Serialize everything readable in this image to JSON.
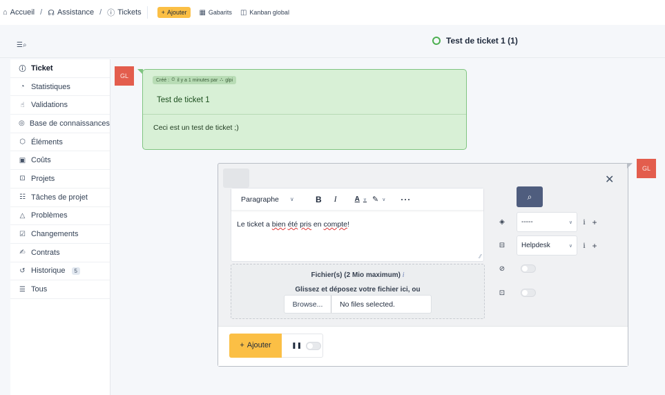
{
  "breadcrumb": {
    "home": "Accueil",
    "assistance": "Assistance",
    "tickets": "Tickets",
    "sep": "/"
  },
  "topbar": {
    "add_label": "Ajouter",
    "templates_label": "Gabarits",
    "kanban_label": "Kanban global"
  },
  "ticket": {
    "title": "Test de ticket 1 (1)",
    "status_color": "#4caf50",
    "created_badge": "Créé : ⏲ il y a 1 minutes par ⛬ glpi",
    "created_label": "Créé :",
    "created_time": "il y a 1 minutes par",
    "created_user": "glpi",
    "content_title": "Test de ticket 1",
    "content_body": "Ceci est un test de ticket ;)"
  },
  "avatar": {
    "initials": "GL",
    "color": "#e35d4d"
  },
  "sidebar": {
    "items": [
      {
        "label": "Ticket",
        "icon": "alert-circle-icon",
        "active": true
      },
      {
        "label": "Statistiques",
        "icon": "chart-pie-icon"
      },
      {
        "label": "Validations",
        "icon": "thumb-up-icon"
      },
      {
        "label": "Base de connaissances",
        "icon": "lifebuoy-icon"
      },
      {
        "label": "Éléments",
        "icon": "package-icon"
      },
      {
        "label": "Coûts",
        "icon": "wallet-icon"
      },
      {
        "label": "Projets",
        "icon": "projects-icon"
      },
      {
        "label": "Tâches de projet",
        "icon": "list-check-icon"
      },
      {
        "label": "Problèmes",
        "icon": "alert-triangle-icon"
      },
      {
        "label": "Changements",
        "icon": "clipboard-check-icon"
      },
      {
        "label": "Contrats",
        "icon": "contract-icon"
      },
      {
        "label": "Historique",
        "icon": "history-icon",
        "badge": "5"
      },
      {
        "label": "Tous",
        "icon": "layers-icon"
      }
    ]
  },
  "editor": {
    "format_select": "Paragraphe",
    "text_before": "Le ticket a ",
    "text_w1": "bien",
    "text_w2": "été",
    "text_w3": "pris",
    "text_mid": " en ",
    "text_w4": "compte",
    "text_end": "!"
  },
  "dropzone": {
    "title": "Fichier(s) (2 Mio maximum)",
    "info": "i",
    "subtitle": "Glissez et déposez votre fichier ici, ou",
    "browse": "Browse...",
    "no_files": "No files selected."
  },
  "options": {
    "category_value": "-----",
    "source_value": "Helpdesk",
    "info_symbol": "i",
    "plus_symbol": "+"
  },
  "footer": {
    "submit_label": "Ajouter"
  }
}
